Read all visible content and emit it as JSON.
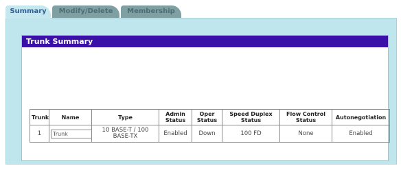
{
  "tabs": [
    {
      "label": "Summary",
      "active": true
    },
    {
      "label": "Modify/Delete",
      "active": false
    },
    {
      "label": "Membership",
      "active": false
    }
  ],
  "trunk_summary": {
    "title": "Trunk Summary",
    "columns": [
      "Trunk",
      "Name",
      "Type",
      "Admin Status",
      "Oper Status",
      "Speed Duplex Status",
      "Flow Control Status",
      "Autonegotiation"
    ],
    "rows": [
      {
        "trunk": "1",
        "name": "Trunk",
        "type": "10 BASE-T / 100 BASE-TX",
        "admin_status": "Enabled",
        "oper_status": "Down",
        "speed_duplex": "100 FD",
        "flow_control": "None",
        "autonegotiation": "Enabled"
      }
    ]
  },
  "colors": {
    "header_bar": "#3a10a8",
    "panel": "#bfe6ec",
    "tab_active": "#c4e8ee",
    "tab_inactive": "#7f9fa3"
  }
}
